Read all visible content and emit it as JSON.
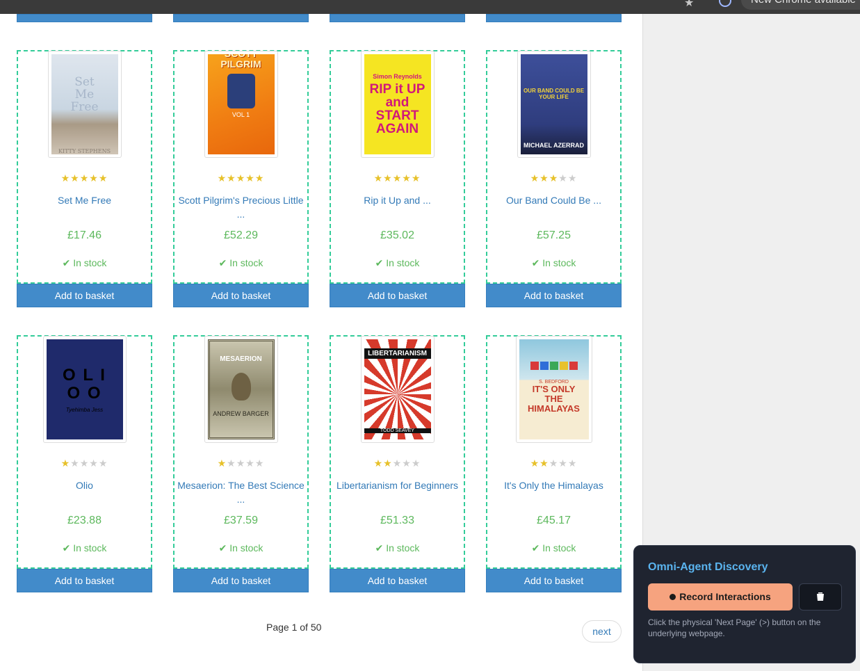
{
  "browser": {
    "update_text": "New Chrome available"
  },
  "products": [
    {
      "title": "Set Me Free",
      "price": "£17.46",
      "stars": 5,
      "stock": "In stock",
      "cover_text": "Set Me Free",
      "cover_author": "KITTY STEPHENS"
    },
    {
      "title": "Scott Pilgrim's Precious Little ...",
      "price": "£52.29",
      "stars": 5,
      "stock": "In stock",
      "cover_text": "SCOTT PILGRIM",
      "cover_author": "VOL 1"
    },
    {
      "title": "Rip it Up and ...",
      "price": "£35.02",
      "stars": 5,
      "stock": "In stock",
      "cover_text": "RIP it UP and START AGAIN",
      "cover_author": "Simon Reynolds"
    },
    {
      "title": "Our Band Could Be ...",
      "price": "£57.25",
      "stars": 3,
      "stock": "In stock",
      "cover_text": "OUR BAND COULD BE YOUR LIFE",
      "cover_author": "MICHAEL AZERRAD"
    },
    {
      "title": "Olio",
      "price": "£23.88",
      "stars": 1,
      "stock": "In stock",
      "cover_text": "O L I O O",
      "cover_author": "Tyehimba Jess"
    },
    {
      "title": "Mesaerion: The Best Science ...",
      "price": "£37.59",
      "stars": 1,
      "stock": "In stock",
      "cover_text": "MESAERION",
      "cover_author": "ANDREW BARGER"
    },
    {
      "title": "Libertarianism for Beginners",
      "price": "£51.33",
      "stars": 2,
      "stock": "In stock",
      "cover_text": "LIBERTARIANISM",
      "cover_author": "TODD SEAVEY"
    },
    {
      "title": "It's Only the Himalayas",
      "price": "£45.17",
      "stars": 2,
      "stock": "In stock",
      "cover_text": "IT'S ONLY THE HIMALAYAS",
      "cover_author": "S. BEDFORD"
    }
  ],
  "buttons": {
    "add_to_basket": "Add to basket"
  },
  "pager": {
    "current": "Page 1 of 50",
    "next": "next"
  },
  "agent_panel": {
    "heading": "Omni-Agent Discovery",
    "record_label": "Record Interactions",
    "hint": "Click the physical 'Next Page' (>) button on the underlying webpage."
  },
  "colors": {
    "accent_blue": "#428bca",
    "link_blue": "#337ab7",
    "stock_green": "#5cb85c",
    "star_gold": "#e7c12a",
    "dashed_border": "#33cc99",
    "panel_bg": "#1f2430",
    "record_orange": "#f6a37f"
  }
}
